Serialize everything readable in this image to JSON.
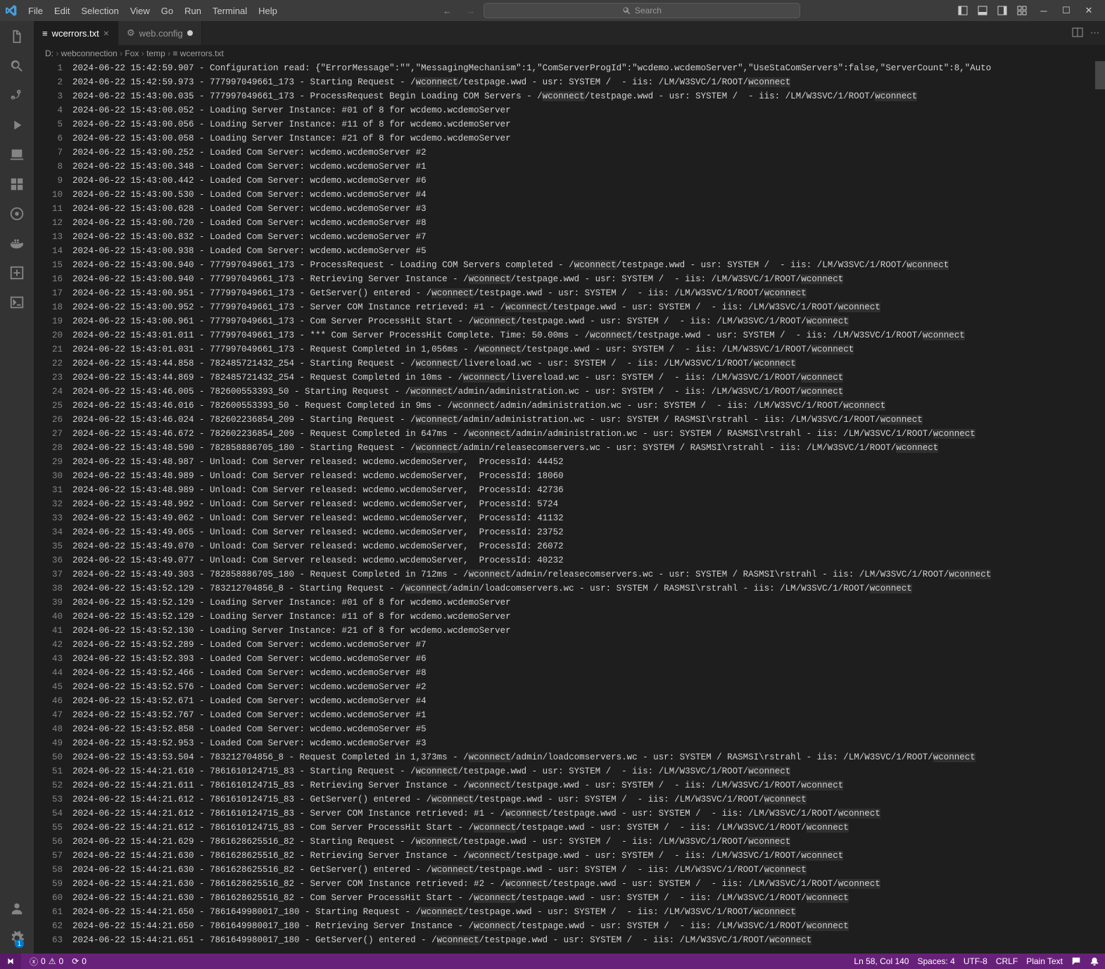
{
  "menu": [
    "File",
    "Edit",
    "Selection",
    "View",
    "Go",
    "Run",
    "Terminal",
    "Help"
  ],
  "search_placeholder": "Search",
  "tabs": [
    {
      "label": "wcerrors.txt",
      "active": true,
      "icon": "≡",
      "dirty": false,
      "close": true
    },
    {
      "label": "web.config",
      "active": false,
      "icon": "⚙",
      "dirty": true
    }
  ],
  "breadcrumb": [
    "D:",
    "webconnection",
    "Fox",
    "temp",
    "≡ wcerrors.txt"
  ],
  "lines": [
    "2024-06-22 15:42:59.907 - Configuration read: {\"ErrorMessage\":\"\",\"MessagingMechanism\":1,\"ComServerProgId\":\"wcdemo.wcdemoServer\",\"UseStaComServers\":false,\"ServerCount\":8,\"Auto",
    "2024-06-22 15:42:59.973 - 777997049661_173 - Starting Request - /wconnect/testpage.wwd - usr: SYSTEM /  - iis: /LM/W3SVC/1/ROOT/wconnect",
    "2024-06-22 15:43:00.035 - 777997049661_173 - ProcessRequest Begin Loading COM Servers - /wconnect/testpage.wwd - usr: SYSTEM /  - iis: /LM/W3SVC/1/ROOT/wconnect",
    "2024-06-22 15:43:00.052 - Loading Server Instance: #01 of 8 for wcdemo.wcdemoServer",
    "2024-06-22 15:43:00.056 - Loading Server Instance: #11 of 8 for wcdemo.wcdemoServer",
    "2024-06-22 15:43:00.058 - Loading Server Instance: #21 of 8 for wcdemo.wcdemoServer",
    "2024-06-22 15:43:00.252 - Loaded Com Server: wcdemo.wcdemoServer #2",
    "2024-06-22 15:43:00.348 - Loaded Com Server: wcdemo.wcdemoServer #1",
    "2024-06-22 15:43:00.442 - Loaded Com Server: wcdemo.wcdemoServer #6",
    "2024-06-22 15:43:00.530 - Loaded Com Server: wcdemo.wcdemoServer #4",
    "2024-06-22 15:43:00.628 - Loaded Com Server: wcdemo.wcdemoServer #3",
    "2024-06-22 15:43:00.720 - Loaded Com Server: wcdemo.wcdemoServer #8",
    "2024-06-22 15:43:00.832 - Loaded Com Server: wcdemo.wcdemoServer #7",
    "2024-06-22 15:43:00.938 - Loaded Com Server: wcdemo.wcdemoServer #5",
    "2024-06-22 15:43:00.940 - 777997049661_173 - ProcessRequest - Loading COM Servers completed - /wconnect/testpage.wwd - usr: SYSTEM /  - iis: /LM/W3SVC/1/ROOT/wconnect",
    "2024-06-22 15:43:00.940 - 777997049661_173 - Retrieving Server Instance - /wconnect/testpage.wwd - usr: SYSTEM /  - iis: /LM/W3SVC/1/ROOT/wconnect",
    "2024-06-22 15:43:00.951 - 777997049661_173 - GetServer() entered - /wconnect/testpage.wwd - usr: SYSTEM /  - iis: /LM/W3SVC/1/ROOT/wconnect",
    "2024-06-22 15:43:00.952 - 777997049661_173 - Server COM Instance retrieved: #1 - /wconnect/testpage.wwd - usr: SYSTEM /  - iis: /LM/W3SVC/1/ROOT/wconnect",
    "2024-06-22 15:43:00.961 - 777997049661_173 - Com Server ProcessHit Start - /wconnect/testpage.wwd - usr: SYSTEM /  - iis: /LM/W3SVC/1/ROOT/wconnect",
    "2024-06-22 15:43:01.011 - 777997049661_173 - *** Com Server ProcessHit Complete. Time: 50.00ms - /wconnect/testpage.wwd - usr: SYSTEM /  - iis: /LM/W3SVC/1/ROOT/wconnect",
    "2024-06-22 15:43:01.031 - 777997049661_173 - Request Completed in 1,056ms - /wconnect/testpage.wwd - usr: SYSTEM /  - iis: /LM/W3SVC/1/ROOT/wconnect",
    "2024-06-22 15:43:44.858 - 782485721432_254 - Starting Request - /wconnect/livereload.wc - usr: SYSTEM /  - iis: /LM/W3SVC/1/ROOT/wconnect",
    "2024-06-22 15:43:44.869 - 782485721432_254 - Request Completed in 10ms - /wconnect/livereload.wc - usr: SYSTEM /  - iis: /LM/W3SVC/1/ROOT/wconnect",
    "2024-06-22 15:43:46.005 - 782600553393_50 - Starting Request - /wconnect/admin/administration.wc - usr: SYSTEM /  - iis: /LM/W3SVC/1/ROOT/wconnect",
    "2024-06-22 15:43:46.016 - 782600553393_50 - Request Completed in 9ms - /wconnect/admin/administration.wc - usr: SYSTEM /  - iis: /LM/W3SVC/1/ROOT/wconnect",
    "2024-06-22 15:43:46.024 - 782602236854_209 - Starting Request - /wconnect/admin/administration.wc - usr: SYSTEM / RASMSI\\rstrahl - iis: /LM/W3SVC/1/ROOT/wconnect",
    "2024-06-22 15:43:46.672 - 782602236854_209 - Request Completed in 647ms - /wconnect/admin/administration.wc - usr: SYSTEM / RASMSI\\rstrahl - iis: /LM/W3SVC/1/ROOT/wconnect",
    "2024-06-22 15:43:48.590 - 782858886705_180 - Starting Request - /wconnect/admin/releasecomservers.wc - usr: SYSTEM / RASMSI\\rstrahl - iis: /LM/W3SVC/1/ROOT/wconnect",
    "2024-06-22 15:43:48.987 - Unload: Com Server released: wcdemo.wcdemoServer,  ProcessId: 44452",
    "2024-06-22 15:43:48.989 - Unload: Com Server released: wcdemo.wcdemoServer,  ProcessId: 18060",
    "2024-06-22 15:43:48.989 - Unload: Com Server released: wcdemo.wcdemoServer,  ProcessId: 42736",
    "2024-06-22 15:43:48.992 - Unload: Com Server released: wcdemo.wcdemoServer,  ProcessId: 5724",
    "2024-06-22 15:43:49.062 - Unload: Com Server released: wcdemo.wcdemoServer,  ProcessId: 41132",
    "2024-06-22 15:43:49.065 - Unload: Com Server released: wcdemo.wcdemoServer,  ProcessId: 23752",
    "2024-06-22 15:43:49.070 - Unload: Com Server released: wcdemo.wcdemoServer,  ProcessId: 26072",
    "2024-06-22 15:43:49.077 - Unload: Com Server released: wcdemo.wcdemoServer,  ProcessId: 40232",
    "2024-06-22 15:43:49.303 - 782858886705_180 - Request Completed in 712ms - /wconnect/admin/releasecomservers.wc - usr: SYSTEM / RASMSI\\rstrahl - iis: /LM/W3SVC/1/ROOT/wconnect",
    "2024-06-22 15:43:52.129 - 783212704856_8 - Starting Request - /wconnect/admin/loadcomservers.wc - usr: SYSTEM / RASMSI\\rstrahl - iis: /LM/W3SVC/1/ROOT/wconnect",
    "2024-06-22 15:43:52.129 - Loading Server Instance: #01 of 8 for wcdemo.wcdemoServer",
    "2024-06-22 15:43:52.129 - Loading Server Instance: #11 of 8 for wcdemo.wcdemoServer",
    "2024-06-22 15:43:52.130 - Loading Server Instance: #21 of 8 for wcdemo.wcdemoServer",
    "2024-06-22 15:43:52.289 - Loaded Com Server: wcdemo.wcdemoServer #7",
    "2024-06-22 15:43:52.393 - Loaded Com Server: wcdemo.wcdemoServer #6",
    "2024-06-22 15:43:52.466 - Loaded Com Server: wcdemo.wcdemoServer #8",
    "2024-06-22 15:43:52.576 - Loaded Com Server: wcdemo.wcdemoServer #2",
    "2024-06-22 15:43:52.671 - Loaded Com Server: wcdemo.wcdemoServer #4",
    "2024-06-22 15:43:52.767 - Loaded Com Server: wcdemo.wcdemoServer #1",
    "2024-06-22 15:43:52.858 - Loaded Com Server: wcdemo.wcdemoServer #5",
    "2024-06-22 15:43:52.953 - Loaded Com Server: wcdemo.wcdemoServer #3",
    "2024-06-22 15:43:53.504 - 783212704856_8 - Request Completed in 1,373ms - /wconnect/admin/loadcomservers.wc - usr: SYSTEM / RASMSI\\rstrahl - iis: /LM/W3SVC/1/ROOT/wconnect",
    "2024-06-22 15:44:21.610 - 7861610124715_83 - Starting Request - /wconnect/testpage.wwd - usr: SYSTEM /  - iis: /LM/W3SVC/1/ROOT/wconnect",
    "2024-06-22 15:44:21.611 - 7861610124715_83 - Retrieving Server Instance - /wconnect/testpage.wwd - usr: SYSTEM /  - iis: /LM/W3SVC/1/ROOT/wconnect",
    "2024-06-22 15:44:21.612 - 7861610124715_83 - GetServer() entered - /wconnect/testpage.wwd - usr: SYSTEM /  - iis: /LM/W3SVC/1/ROOT/wconnect",
    "2024-06-22 15:44:21.612 - 7861610124715_83 - Server COM Instance retrieved: #1 - /wconnect/testpage.wwd - usr: SYSTEM /  - iis: /LM/W3SVC/1/ROOT/wconnect",
    "2024-06-22 15:44:21.612 - 7861610124715_83 - Com Server ProcessHit Start - /wconnect/testpage.wwd - usr: SYSTEM /  - iis: /LM/W3SVC/1/ROOT/wconnect",
    "2024-06-22 15:44:21.629 - 7861628625516_82 - Starting Request - /wconnect/testpage.wwd - usr: SYSTEM /  - iis: /LM/W3SVC/1/ROOT/wconnect",
    "2024-06-22 15:44:21.630 - 7861628625516_82 - Retrieving Server Instance - /wconnect/testpage.wwd - usr: SYSTEM /  - iis: /LM/W3SVC/1/ROOT/wconnect",
    "2024-06-22 15:44:21.630 - 7861628625516_82 - GetServer() entered - /wconnect/testpage.wwd - usr: SYSTEM /  - iis: /LM/W3SVC/1/ROOT/wconnect",
    "2024-06-22 15:44:21.630 - 7861628625516_82 - Server COM Instance retrieved: #2 - /wconnect/testpage.wwd - usr: SYSTEM /  - iis: /LM/W3SVC/1/ROOT/wconnect",
    "2024-06-22 15:44:21.630 - 7861628625516_82 - Com Server ProcessHit Start - /wconnect/testpage.wwd - usr: SYSTEM /  - iis: /LM/W3SVC/1/ROOT/wconnect",
    "2024-06-22 15:44:21.650 - 7861649980017_180 - Starting Request - /wconnect/testpage.wwd - usr: SYSTEM /  - iis: /LM/W3SVC/1/ROOT/wconnect",
    "2024-06-22 15:44:21.650 - 7861649980017_180 - Retrieving Server Instance - /wconnect/testpage.wwd - usr: SYSTEM /  - iis: /LM/W3SVC/1/ROOT/wconnect",
    "2024-06-22 15:44:21.651 - 7861649980017_180 - GetServer() entered - /wconnect/testpage.wwd - usr: SYSTEM /  - iis: /LM/W3SVC/1/ROOT/wconnect"
  ],
  "highlight_token": "wconnect",
  "statusbar": {
    "errors": "0",
    "warnings": "0",
    "ports": "0",
    "cursor": "Ln 58, Col 140",
    "spaces": "Spaces: 4",
    "encoding": "UTF-8",
    "eol": "CRLF",
    "language": "Plain Text"
  }
}
